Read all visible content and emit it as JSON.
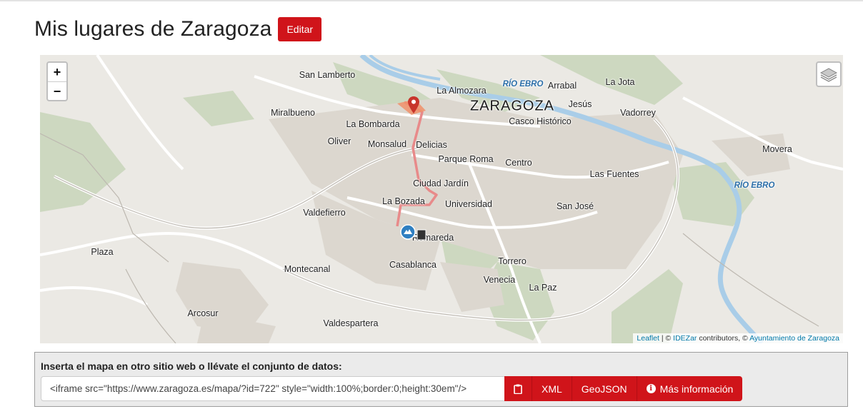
{
  "header": {
    "title": "Mis lugares de Zaragoza",
    "edit_label": "Editar"
  },
  "map": {
    "zoom_in": "+",
    "zoom_out": "−",
    "labels": {
      "san_lamberto": "San Lamberto",
      "la_almozara": "La Almozara",
      "rio_ebro_north": "RÍO EBRO",
      "arrabal": "Arrabal",
      "la_jota": "La Jota",
      "miralbueno": "Miralbueno",
      "zaragoza": "ZARAGOZA",
      "jesus": "Jesús",
      "vadorrey": "Vadorrey",
      "casco_historico": "Casco Histórico",
      "la_bombarda": "La Bombarda",
      "oliver": "Oliver",
      "monsalud": "Monsalud",
      "delicias": "Delicias",
      "movera": "Movera",
      "parque_roma": "Parque Roma",
      "centro": "Centro",
      "las_fuentes": "Las Fuentes",
      "rio_ebro_east": "RÍO EBRO",
      "ciudad_jardin": "Ciudad Jardín",
      "la_bozada": "La Bozada",
      "universidad": "Universidad",
      "san_jose": "San José",
      "valdefierro": "Valdefierro",
      "romareda": "Romareda",
      "plaza": "Plaza",
      "torrero": "Torrero",
      "casablanca": "Casablanca",
      "montecanal": "Montecanal",
      "venecia": "Venecia",
      "la_paz": "La Paz",
      "arcosur": "Arcosur",
      "valdespartera": "Valdespartera"
    },
    "attribution": {
      "leaflet": "Leaflet",
      "sep1": " | © ",
      "idezar": "IDEZar",
      "mid": " contributors, © ",
      "ayuntamiento": "Ayuntamiento de Zaragoza"
    },
    "colors": {
      "background": "#ebe9e4",
      "park": "#c9d6bc",
      "river": "#a6cdeb",
      "road": "#ffffff",
      "route": "#e88a8a",
      "marker_red": "#c8352b",
      "marker_blue": "#2f7fc1"
    }
  },
  "embed": {
    "heading": "Inserta el mapa en otro sitio web o llévate el conjunto de datos:",
    "code": "<iframe src=\"https://www.zaragoza.es/mapa/?id=722\" style=\"width:100%;border:0;height:30em\"/>",
    "copy_icon": "clipboard-icon",
    "xml_label": "XML",
    "geojson_label": "GeoJSON",
    "info_icon": "info-circle-icon",
    "more_info_label": "Más información"
  }
}
